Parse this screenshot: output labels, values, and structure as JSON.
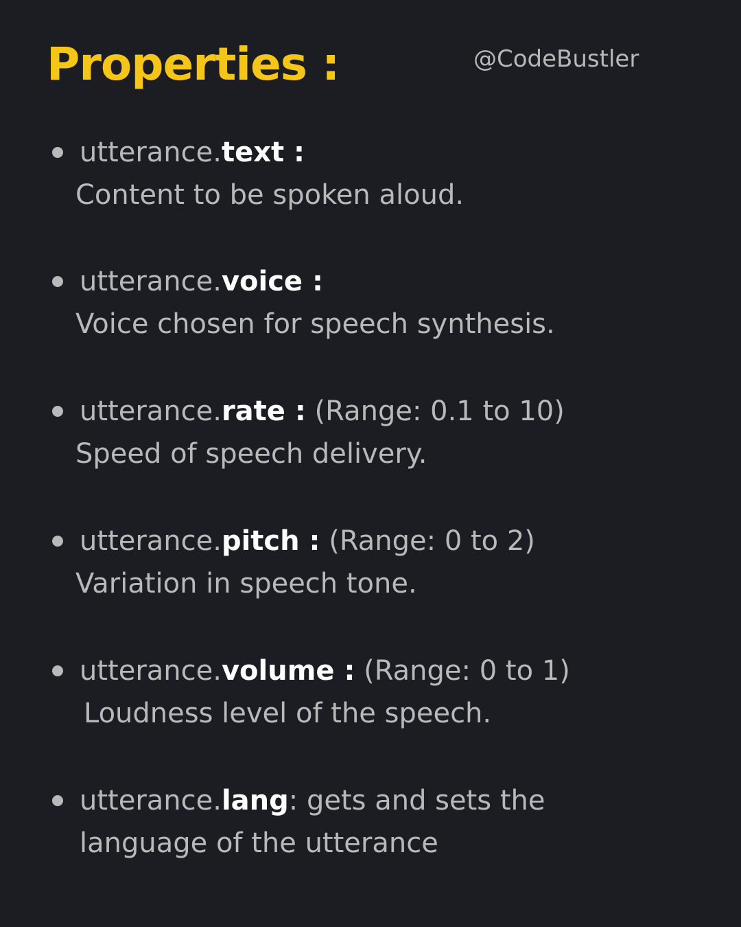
{
  "header": {
    "title": "Properties :",
    "handle": "@CodeBustler"
  },
  "properties": [
    {
      "prefix": "utterance.",
      "key": "text",
      "colon": " :",
      "range": "",
      "description": "Content to be spoken aloud."
    },
    {
      "prefix": "utterance.",
      "key": "voice",
      "colon": " :",
      "range": "",
      "description": "Voice chosen for speech synthesis."
    },
    {
      "prefix": "utterance.",
      "key": "rate",
      "colon": " :",
      "range": " (Range: 0.1 to 10)",
      "description": "Speed of speech delivery."
    },
    {
      "prefix": "utterance.",
      "key": "pitch",
      "colon": " :",
      "range": "  (Range: 0 to 2)",
      "description": "Variation in speech tone."
    },
    {
      "prefix": "utterance.",
      "key": "volume",
      "colon": " :",
      "range": "  (Range: 0 to 1)",
      "description": "Loudness level of the speech."
    },
    {
      "prefix": "utterance.",
      "key": "lang",
      "colon": ":",
      "range": " gets and sets the",
      "description": "language of the utterance"
    }
  ]
}
